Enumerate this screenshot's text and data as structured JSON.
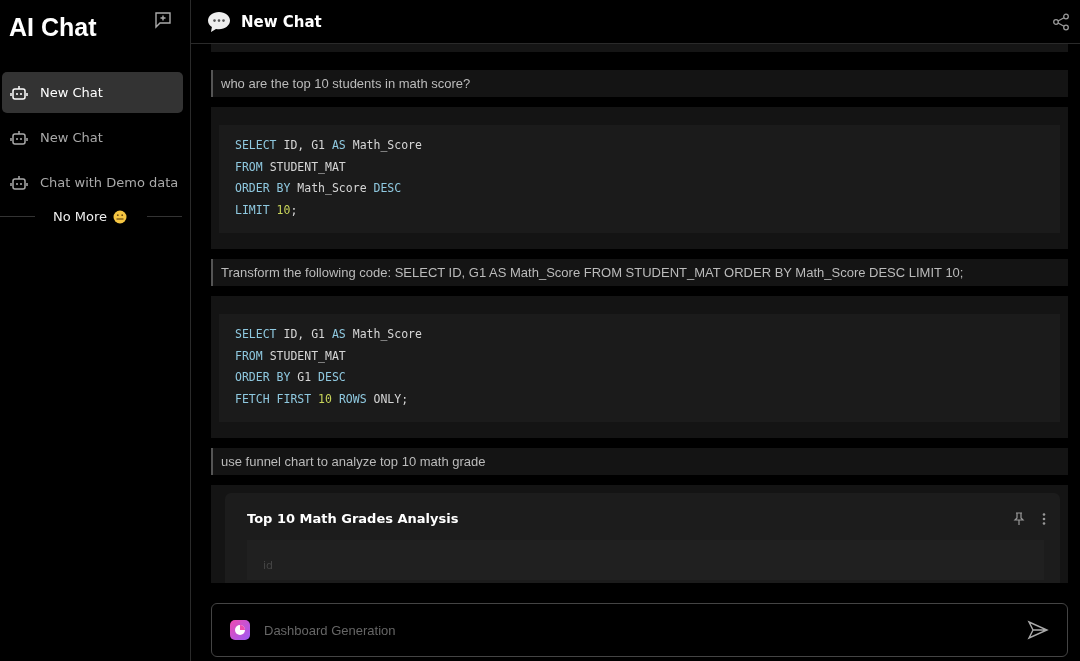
{
  "sidebar": {
    "title": "AI Chat",
    "items": [
      {
        "label": "New Chat",
        "selected": true
      },
      {
        "label": "New Chat",
        "selected": false
      },
      {
        "label": "Chat with Demo data",
        "selected": false
      }
    ],
    "end_label": "No More"
  },
  "header": {
    "title": "New Chat"
  },
  "messages": [
    {
      "kind": "user",
      "text": "who are the top 10 students in math score?"
    },
    {
      "kind": "code",
      "lines": [
        [
          {
            "text": "SELECT",
            "kind": "keyword"
          },
          {
            "text": " ID, G1 ",
            "kind": "plain"
          },
          {
            "text": "AS",
            "kind": "keyword"
          },
          {
            "text": " Math_Score",
            "kind": "plain"
          }
        ],
        [
          {
            "text": "FROM",
            "kind": "keyword"
          },
          {
            "text": " STUDENT_MAT",
            "kind": "plain"
          }
        ],
        [
          {
            "text": "ORDER BY",
            "kind": "keyword"
          },
          {
            "text": " Math_Score ",
            "kind": "plain"
          },
          {
            "text": "DESC",
            "kind": "keyword"
          }
        ],
        [
          {
            "text": "LIMIT",
            "kind": "keyword"
          },
          {
            "text": " 10",
            "kind": "number"
          },
          {
            "text": ";",
            "kind": "plain"
          }
        ]
      ]
    },
    {
      "kind": "user",
      "text": "Transform the following code: SELECT ID, G1 AS Math_Score FROM STUDENT_MAT ORDER BY Math_Score DESC LIMIT 10;"
    },
    {
      "kind": "code",
      "lines": [
        [
          {
            "text": "SELECT",
            "kind": "keyword"
          },
          {
            "text": " ID, G1 ",
            "kind": "plain"
          },
          {
            "text": "AS",
            "kind": "keyword"
          },
          {
            "text": " Math_Score",
            "kind": "plain"
          }
        ],
        [
          {
            "text": "FROM",
            "kind": "keyword"
          },
          {
            "text": " STUDENT_MAT",
            "kind": "plain"
          }
        ],
        [
          {
            "text": "ORDER BY",
            "kind": "keyword"
          },
          {
            "text": " G1 ",
            "kind": "plain"
          },
          {
            "text": "DESC",
            "kind": "keyword"
          }
        ],
        [
          {
            "text": "FETCH FIRST",
            "kind": "keyword"
          },
          {
            "text": " 10",
            "kind": "number"
          },
          {
            "text": " ROWS",
            "kind": "keyword"
          },
          {
            "text": " ONLY;",
            "kind": "plain"
          }
        ]
      ]
    },
    {
      "kind": "user",
      "text": "use funnel chart to analyze top 10 math grade"
    },
    {
      "kind": "chart_card",
      "title": "Top 10 Math Grades Analysis",
      "field_label": "id"
    }
  ],
  "input": {
    "placeholder": "Dashboard Generation"
  }
}
